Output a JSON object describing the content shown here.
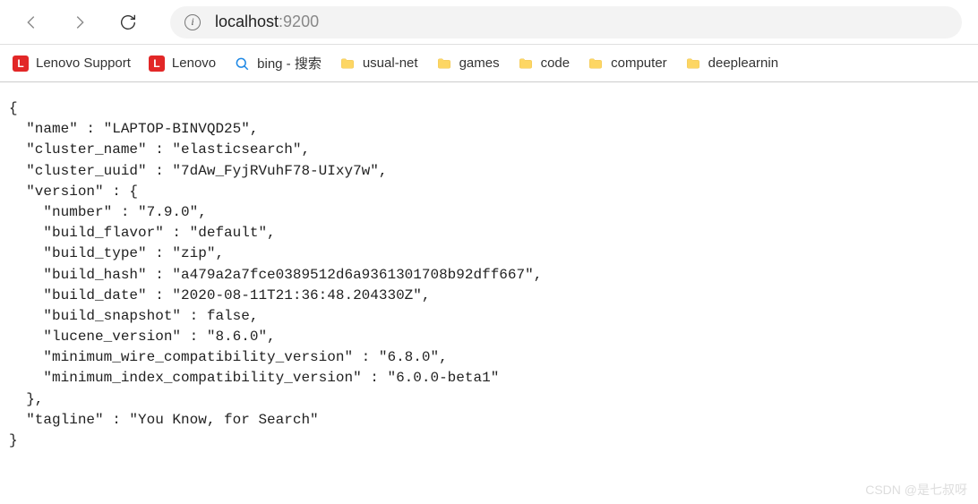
{
  "url": {
    "domain": "localhost",
    "port": ":9200"
  },
  "bookmarks": {
    "lenovo_support": "Lenovo Support",
    "lenovo": "Lenovo",
    "bing": "bing - 搜索",
    "usual_net": "usual-net",
    "games": "games",
    "code": "code",
    "computer": "computer",
    "deeplearning": "deeplearnin"
  },
  "json_body": {
    "name": "LAPTOP-BINVQD25",
    "cluster_name": "elasticsearch",
    "cluster_uuid": "7dAw_FyjRVuhF78-UIxy7w",
    "version": {
      "number": "7.9.0",
      "build_flavor": "default",
      "build_type": "zip",
      "build_hash": "a479a2a7fce0389512d6a9361301708b92dff667",
      "build_date": "2020-08-11T21:36:48.204330Z",
      "build_snapshot": false,
      "lucene_version": "8.6.0",
      "minimum_wire_compatibility_version": "6.8.0",
      "minimum_index_compatibility_version": "6.0.0-beta1"
    },
    "tagline": "You Know, for Search"
  },
  "watermark": "CSDN @是七叔呀"
}
